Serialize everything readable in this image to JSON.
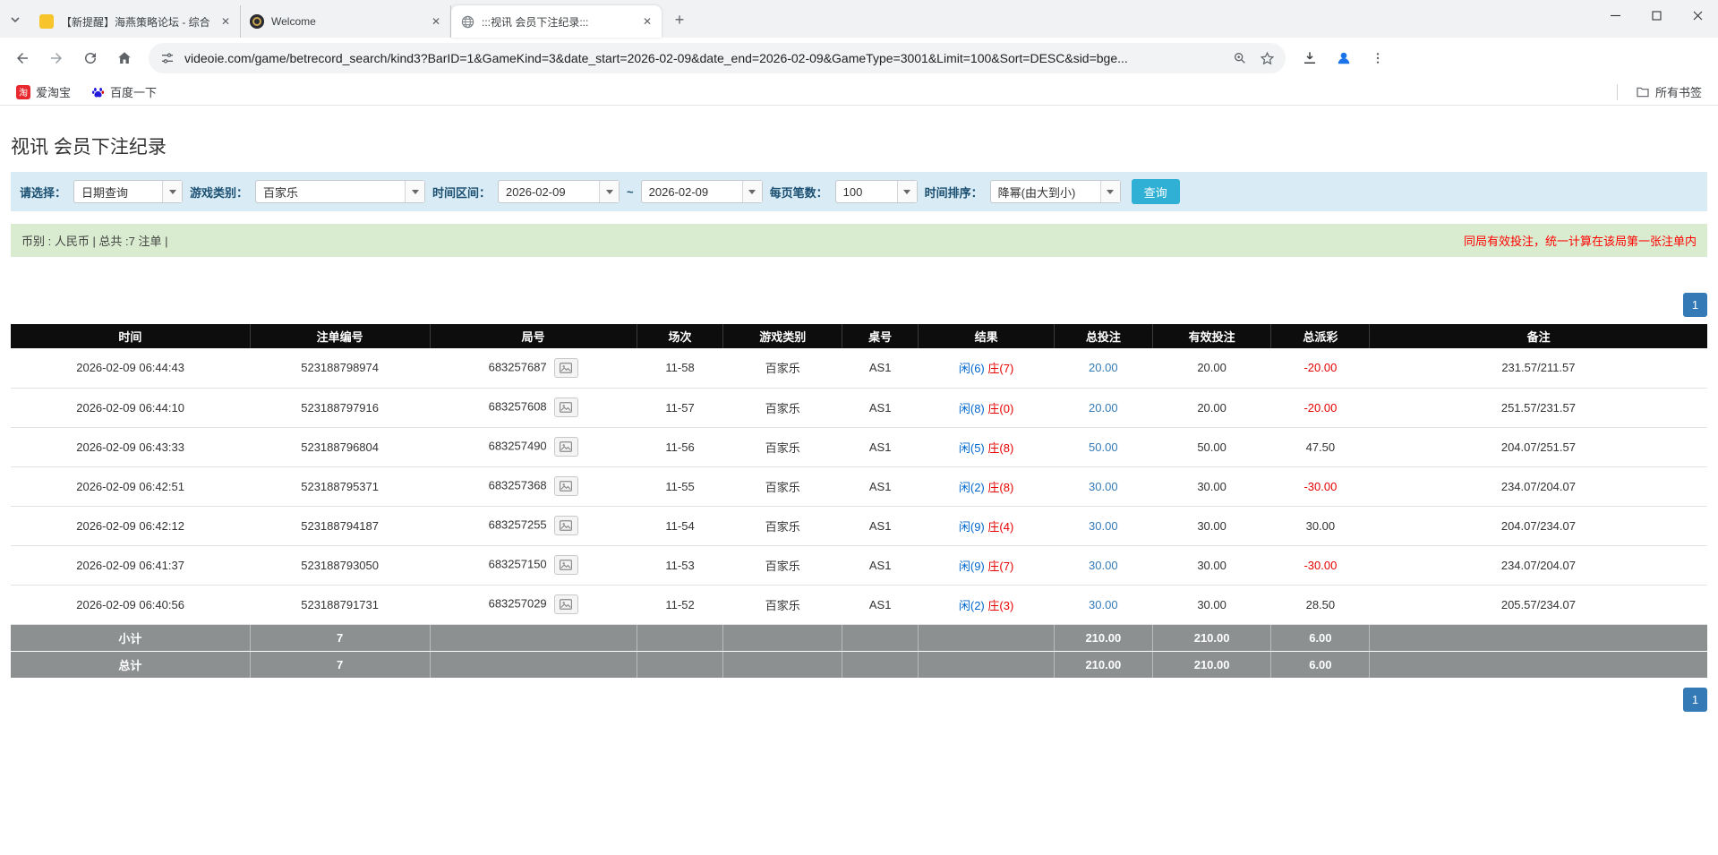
{
  "icons": {
    "taobao_glyph": "淘",
    "tab_close": "✕",
    "new_tab": "+"
  },
  "browser": {
    "tabs": [
      {
        "title": "【新提醒】海燕策略论坛 - 综合",
        "active": false
      },
      {
        "title": "Welcome",
        "active": false
      },
      {
        "title": ":::视讯 会员下注纪录:::",
        "active": true
      }
    ],
    "url": "videoie.com/game/betrecord_search/kind3?BarID=1&GameKind=3&date_start=2026-02-09&date_end=2026-02-09&GameType=3001&Limit=100&Sort=DESC&sid=bge...",
    "bookmarks": [
      {
        "label": "爱淘宝"
      },
      {
        "label": "百度一下"
      }
    ],
    "all_bookmarks_label": "所有书签"
  },
  "page": {
    "title": "视讯 会员下注纪录",
    "filters": {
      "select_label": "请选择：",
      "select_value": "日期查询",
      "game_type_label": "游戏类别：",
      "game_type_value": "百家乐",
      "date_range_label": "时间区间：",
      "date_start": "2026-02-09",
      "date_separator": "~",
      "date_end": "2026-02-09",
      "page_size_label": "每页笔数：",
      "page_size_value": "100",
      "sort_label": "时间排序：",
      "sort_value": "降幂(由大到小)",
      "search_button": "查询"
    },
    "summary": {
      "left": "币别 : 人民币 | 总共 :7 注单 |",
      "right": "同局有效投注，统一计算在该局第一张注单内"
    },
    "pagination": {
      "page": "1"
    },
    "table": {
      "headers": {
        "time": "时间",
        "bet_id": "注单编号",
        "round": "局号",
        "session": "场次",
        "game": "游戏类别",
        "table_no": "桌号",
        "result": "结果",
        "total_bet": "总投注",
        "valid_bet": "有效投注",
        "payout": "总派彩",
        "remark": "备注"
      },
      "rows": [
        {
          "time": "2026-02-09 06:44:43",
          "bet_id": "523188798974",
          "round_id": "683257687",
          "session": "11-58",
          "game": "百家乐",
          "table_no": "AS1",
          "result_player": "闲(6)",
          "result_banker": "庄(7)",
          "total_bet": "20.00",
          "valid_bet": "20.00",
          "payout": "-20.00",
          "payout_class": "neg",
          "remark": "231.57/211.57"
        },
        {
          "time": "2026-02-09 06:44:10",
          "bet_id": "523188797916",
          "round_id": "683257608",
          "session": "11-57",
          "game": "百家乐",
          "table_no": "AS1",
          "result_player": "闲(8)",
          "result_banker": "庄(0)",
          "total_bet": "20.00",
          "valid_bet": "20.00",
          "payout": "-20.00",
          "payout_class": "neg",
          "remark": "251.57/231.57"
        },
        {
          "time": "2026-02-09 06:43:33",
          "bet_id": "523188796804",
          "round_id": "683257490",
          "session": "11-56",
          "game": "百家乐",
          "table_no": "AS1",
          "result_player": "闲(5)",
          "result_banker": "庄(8)",
          "total_bet": "50.00",
          "valid_bet": "50.00",
          "payout": "47.50",
          "payout_class": "pos",
          "remark": "204.07/251.57"
        },
        {
          "time": "2026-02-09 06:42:51",
          "bet_id": "523188795371",
          "round_id": "683257368",
          "session": "11-55",
          "game": "百家乐",
          "table_no": "AS1",
          "result_player": "闲(2)",
          "result_banker": "庄(8)",
          "total_bet": "30.00",
          "valid_bet": "30.00",
          "payout": "-30.00",
          "payout_class": "neg",
          "remark": "234.07/204.07"
        },
        {
          "time": "2026-02-09 06:42:12",
          "bet_id": "523188794187",
          "round_id": "683257255",
          "session": "11-54",
          "game": "百家乐",
          "table_no": "AS1",
          "result_player": "闲(9)",
          "result_banker": "庄(4)",
          "total_bet": "30.00",
          "valid_bet": "30.00",
          "payout": "30.00",
          "payout_class": "pos",
          "remark": "204.07/234.07"
        },
        {
          "time": "2026-02-09 06:41:37",
          "bet_id": "523188793050",
          "round_id": "683257150",
          "session": "11-53",
          "game": "百家乐",
          "table_no": "AS1",
          "result_player": "闲(9)",
          "result_banker": "庄(7)",
          "total_bet": "30.00",
          "valid_bet": "30.00",
          "payout": "-30.00",
          "payout_class": "neg",
          "remark": "234.07/204.07"
        },
        {
          "time": "2026-02-09 06:40:56",
          "bet_id": "523188791731",
          "round_id": "683257029",
          "session": "11-52",
          "game": "百家乐",
          "table_no": "AS1",
          "result_player": "闲(2)",
          "result_banker": "庄(3)",
          "total_bet": "30.00",
          "valid_bet": "30.00",
          "payout": "28.50",
          "payout_class": "pos",
          "remark": "205.57/234.07"
        }
      ],
      "subtotal": {
        "label": "小计",
        "count": "7",
        "total_bet": "210.00",
        "valid_bet": "210.00",
        "payout": "6.00"
      },
      "total": {
        "label": "总计",
        "count": "7",
        "total_bet": "210.00",
        "valid_bet": "210.00",
        "payout": "6.00"
      }
    }
  }
}
